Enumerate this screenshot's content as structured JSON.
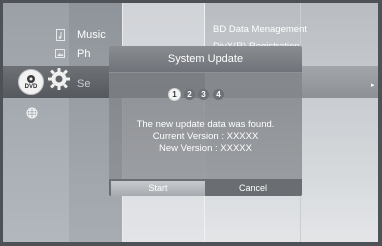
{
  "menu": {
    "items": [
      {
        "id": "music",
        "label": "Music",
        "icon": "music-note-icon"
      },
      {
        "id": "photo",
        "label": "Ph",
        "icon": "photo-icon"
      },
      {
        "id": "settings",
        "label": "Se",
        "icon": "gear-icon"
      }
    ],
    "disc_badge": "DVD",
    "network_icon": "globe-icon"
  },
  "submenu": {
    "items": [
      "BD Data Menagement",
      "DivX(R) Registration"
    ],
    "selected_indicator": "▸"
  },
  "dialog": {
    "title": "System Update",
    "steps": [
      "1",
      "2",
      "3",
      "4"
    ],
    "active_step": 1,
    "message_line1": "The new update data was found.",
    "message_line2": "Current Version : XXXXX",
    "message_line3": "New Version : XXXXX",
    "start_label": "Start",
    "cancel_label": "Cancel"
  },
  "colors": {
    "frame": "#4e5257",
    "column_dark": "#a8adb3",
    "highlight_band": "#5f6368"
  }
}
